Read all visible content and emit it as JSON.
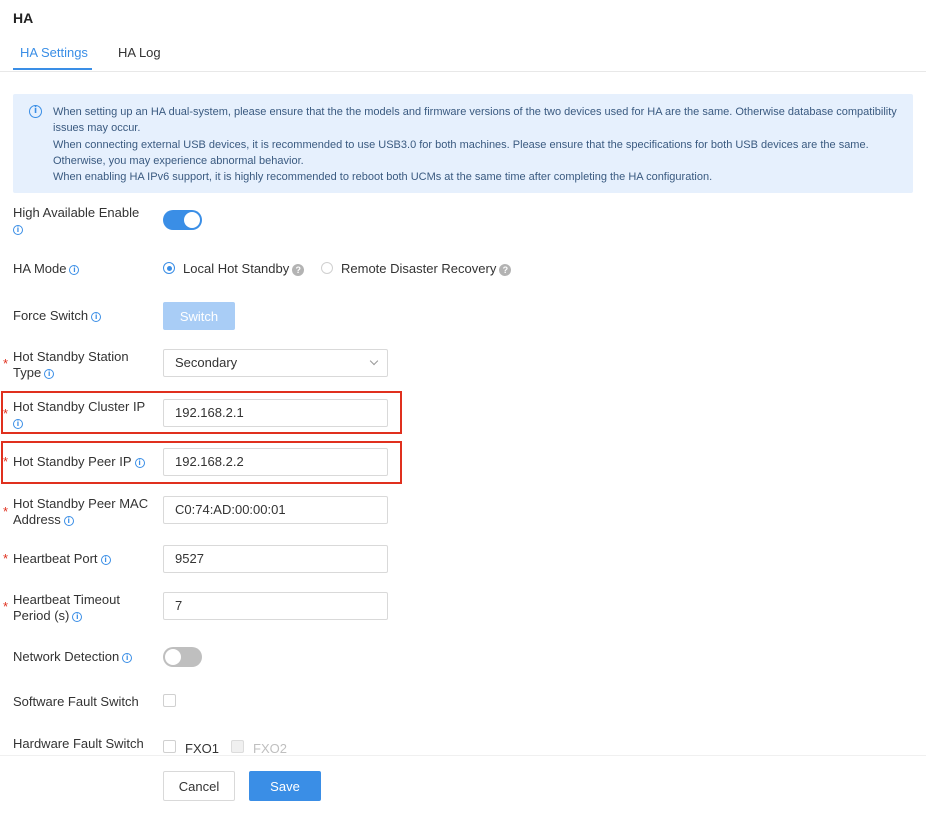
{
  "page": {
    "title": "HA"
  },
  "tabs": [
    {
      "label": "HA Settings",
      "active": true
    },
    {
      "label": "HA Log",
      "active": false
    }
  ],
  "notice": {
    "lines": [
      "When setting up an HA dual-system, please ensure that the the models and firmware versions of the two devices used for HA are the same. Otherwise database compatibility issues may occur.",
      "When connecting external USB devices, it is recommended to use USB3.0 for both machines. Please ensure that the specifications for both USB devices are the same. Otherwise, you may experience abnormal behavior.",
      "When enabling HA IPv6 support, it is highly recommended to reboot both UCMs at the same time after completing the HA configuration."
    ]
  },
  "form": {
    "high_available_enable": {
      "label": "High Available Enable",
      "enabled": true
    },
    "ha_mode": {
      "label": "HA Mode",
      "options": [
        {
          "label": "Local Hot Standby",
          "checked": true
        },
        {
          "label": "Remote Disaster Recovery",
          "checked": false
        }
      ]
    },
    "force_switch": {
      "label": "Force Switch",
      "button_label": "Switch"
    },
    "station_type": {
      "label": "Hot Standby Station Type",
      "value": "Secondary"
    },
    "cluster_ip": {
      "label": "Hot Standby Cluster IP",
      "value": "192.168.2.1"
    },
    "peer_ip": {
      "label": "Hot Standby Peer IP",
      "value": "192.168.2.2"
    },
    "peer_mac": {
      "label": "Hot Standby Peer MAC Address",
      "value": "C0:74:AD:00:00:01"
    },
    "heartbeat_port": {
      "label": "Heartbeat Port",
      "value": "9527"
    },
    "heartbeat_timeout": {
      "label": "Heartbeat Timeout Period (s)",
      "value": "7"
    },
    "network_detection": {
      "label": "Network Detection",
      "enabled": false
    },
    "software_fault_switch": {
      "label": "Software Fault Switch",
      "checked": false
    },
    "hardware_fault_switch": {
      "label": "Hardware Fault Switch",
      "options": [
        {
          "label": "FXO1",
          "checked": false,
          "disabled": false
        },
        {
          "label": "FXO2",
          "checked": false,
          "disabled": true
        }
      ]
    }
  },
  "footer": {
    "cancel_label": "Cancel",
    "save_label": "Save"
  },
  "icons": {
    "info": "info-icon",
    "help": "question-mark-icon"
  },
  "colors": {
    "accent": "#3a8ee6",
    "highlight": "#e0301e",
    "notice_bg": "#e6f0fd"
  }
}
